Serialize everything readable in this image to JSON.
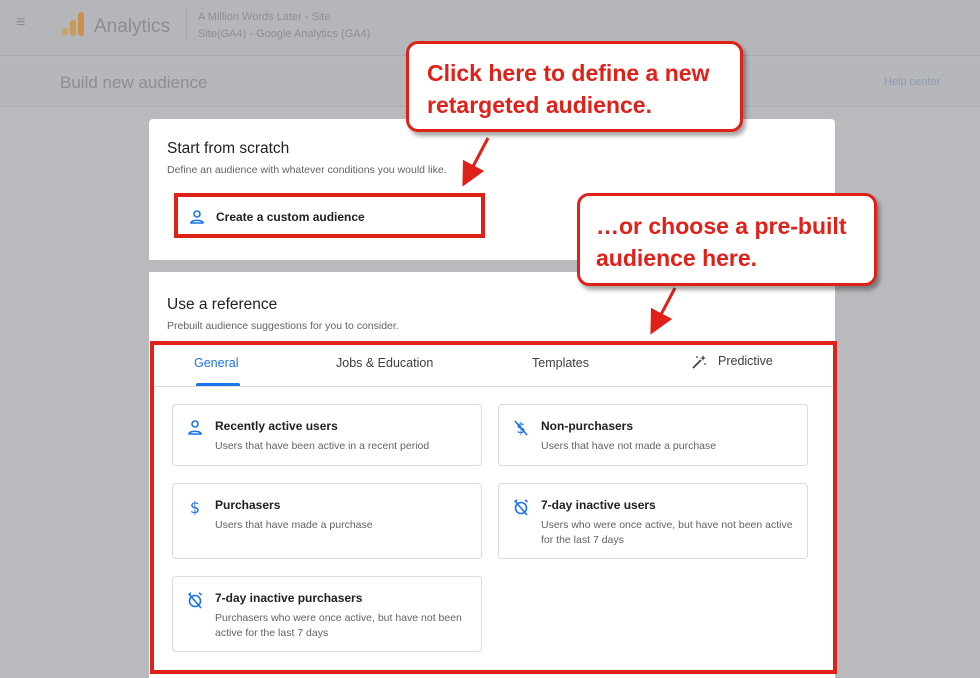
{
  "app": {
    "menu_icon": "≡",
    "name": "Analytics",
    "account_line1": "A Million Words Later - Site",
    "account_line2": "Site(GA4) - Google Analytics (GA4)"
  },
  "page": {
    "title": "Build new audience",
    "help_label": "Help center"
  },
  "scratch": {
    "heading": "Start from scratch",
    "description": "Define an audience with whatever conditions you would like.",
    "custom_button_label": "Create a custom audience"
  },
  "reference": {
    "heading": "Use a reference",
    "description": "Prebuilt audience suggestions for you to consider."
  },
  "tabs": [
    {
      "label": "General",
      "active": true
    },
    {
      "label": "Jobs & Education"
    },
    {
      "label": "Templates"
    },
    {
      "label": "Predictive",
      "icon": "magic-wand-icon"
    }
  ],
  "tiles": [
    {
      "title": "Recently active users",
      "description": "Users that have been active in a recent period",
      "icon": "person-icon"
    },
    {
      "title": "Non-purchasers",
      "description": "Users that have not made a purchase",
      "icon": "no-dollar-icon"
    },
    {
      "title": "Purchasers",
      "description": "Users that have made a purchase",
      "icon": "dollar-icon"
    },
    {
      "title": "7-day inactive users",
      "description": "Users who were once active, but have not been active for the last 7 days",
      "icon": "alarm-off-icon"
    },
    {
      "title": "7-day inactive purchasers",
      "description": "Purchasers who were once active, but have not been active for the last 7 days",
      "icon": "alarm-off-icon"
    }
  ],
  "callouts": {
    "top_line1": "Click here to define a new",
    "top_line2": "retargeted audience.",
    "right_line1": "…or choose a pre-built",
    "right_line2": "audience here."
  },
  "colors": {
    "accent_blue": "#1a73e8",
    "annotation_red": "#e02119"
  }
}
